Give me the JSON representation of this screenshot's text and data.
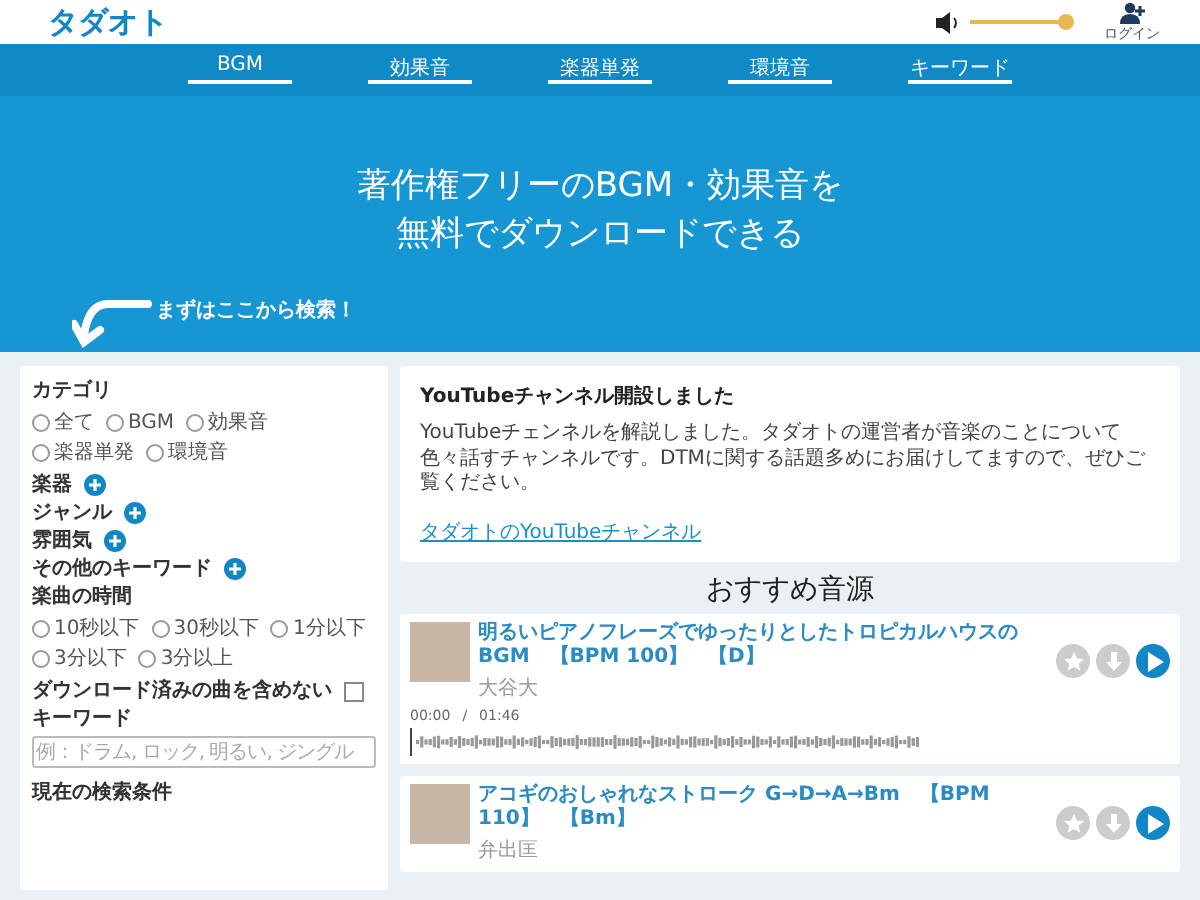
{
  "header": {
    "logo": "タダオト",
    "volume": {
      "level": 1
    },
    "login": "ログイン"
  },
  "nav": [
    {
      "label": "BGM"
    },
    {
      "label": "効果音"
    },
    {
      "label": "楽器単発"
    },
    {
      "label": "環境音"
    },
    {
      "label": "キーワード"
    }
  ],
  "hero": {
    "title_line1": "著作権フリーのBGM・効果音を",
    "title_line2": "無料でダウンロードできる",
    "hint": "まずはここから検索！"
  },
  "sidebar": {
    "category_label": "カテゴリ",
    "categories": [
      {
        "label": "全て",
        "selected": false
      },
      {
        "label": "BGM",
        "selected": false
      },
      {
        "label": "効果音",
        "selected": false
      },
      {
        "label": "楽器単発",
        "selected": false
      },
      {
        "label": "環境音",
        "selected": false
      }
    ],
    "expanders": [
      {
        "label": "楽器"
      },
      {
        "label": "ジャンル"
      },
      {
        "label": "雰囲気"
      },
      {
        "label": "その他のキーワード"
      }
    ],
    "duration_label": "楽曲の時間",
    "durations": [
      {
        "label": "10秒以下",
        "selected": false
      },
      {
        "label": "30秒以下",
        "selected": false
      },
      {
        "label": "1分以下",
        "selected": false
      },
      {
        "label": "3分以下",
        "selected": false
      },
      {
        "label": "3分以上",
        "selected": false
      }
    ],
    "exclude_downloaded": {
      "label": "ダウンロード済みの曲を含めない",
      "checked": false
    },
    "keyword_label": "キーワード",
    "keyword_placeholder": "例：ドラム, ロック, 明るい, ジングル",
    "current_conditions": "現在の検索条件"
  },
  "news": {
    "title": "YouTubeチャンネル開設しました",
    "body": "YouTubeチェンネルを解説しました。タダオトの運営者が音楽のことについて色々話すチャンネルです。DTMに関する話題多めにお届けしてますので、ぜひご覧ください。",
    "link": "タダオトのYouTubeチャンネル"
  },
  "recommended_title": "おすすめ音源",
  "tracks": [
    {
      "title": "明るいピアノフレーズでゆったりとしたトロピカルハウスのBGM　【BPM 100】　【D】",
      "artist": "大谷大",
      "time": "00:00",
      "separator": "/",
      "duration": "01:46"
    },
    {
      "title": "アコギのおしゃれなストローク G→D→A→Bm　【BPM 110】　【Bm】",
      "artist": "弁出匡"
    }
  ]
}
